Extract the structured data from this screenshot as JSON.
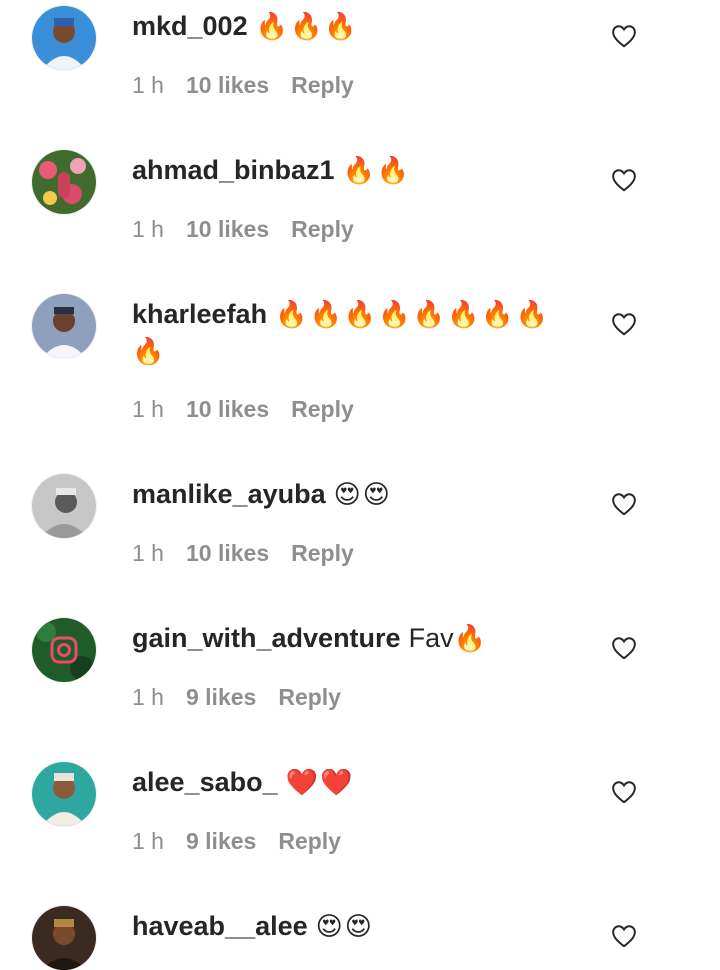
{
  "comments": [
    {
      "username": "mkd_002",
      "text": "",
      "emoji": "🔥🔥🔥",
      "time": "1 h",
      "likes": "10 likes",
      "reply": "Reply",
      "avatar_color": "#3b8fd9"
    },
    {
      "username": "ahmad_binbaz1",
      "text": "",
      "emoji": "🔥🔥",
      "time": "1 h",
      "likes": "10 likes",
      "reply": "Reply",
      "avatar_color": "#c9425a"
    },
    {
      "username": "kharleefah",
      "text": "",
      "emoji": "🔥🔥🔥🔥🔥🔥🔥🔥🔥",
      "time": "1 h",
      "likes": "10 likes",
      "reply": "Reply",
      "avatar_color": "#7d8ea8"
    },
    {
      "username": "manlike_ayuba",
      "text": "",
      "emoji": "😍😍",
      "time": "1 h",
      "likes": "10 likes",
      "reply": "Reply",
      "avatar_color": "#9a9a9a"
    },
    {
      "username": "gain_with_adventure",
      "text": "Fav",
      "emoji": "🔥",
      "time": "1 h",
      "likes": "9 likes",
      "reply": "Reply",
      "avatar_color": "#1f5c2a"
    },
    {
      "username": "alee_sabo_",
      "text": "",
      "emoji": "❤️❤️",
      "time": "1 h",
      "likes": "9 likes",
      "reply": "Reply",
      "avatar_color": "#2fa7a1"
    },
    {
      "username": "haveab__alee",
      "text": "",
      "emoji": "😍😍",
      "time": "",
      "likes": "",
      "reply": "",
      "avatar_color": "#3a2a1f"
    }
  ]
}
